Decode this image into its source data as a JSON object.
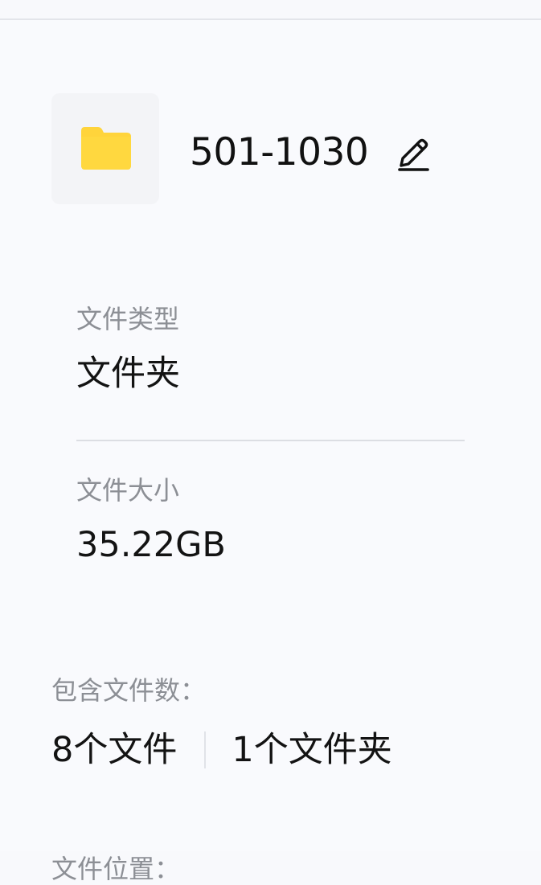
{
  "file": {
    "name": "501-1030",
    "icon": "folder-icon",
    "icon_color": "#ffd43b"
  },
  "details": {
    "type_label": "文件类型",
    "type_value": "文件夹",
    "size_label": "文件大小",
    "size_value": "35.22GB",
    "contains_label": "包含文件数：",
    "files_count": "8个文件",
    "folders_count": "1个文件夹",
    "location_label": "文件位置："
  },
  "colors": {
    "background": "#f9fafd",
    "label": "#8c8f95",
    "text": "#131313",
    "divider": "#dcdee3"
  }
}
